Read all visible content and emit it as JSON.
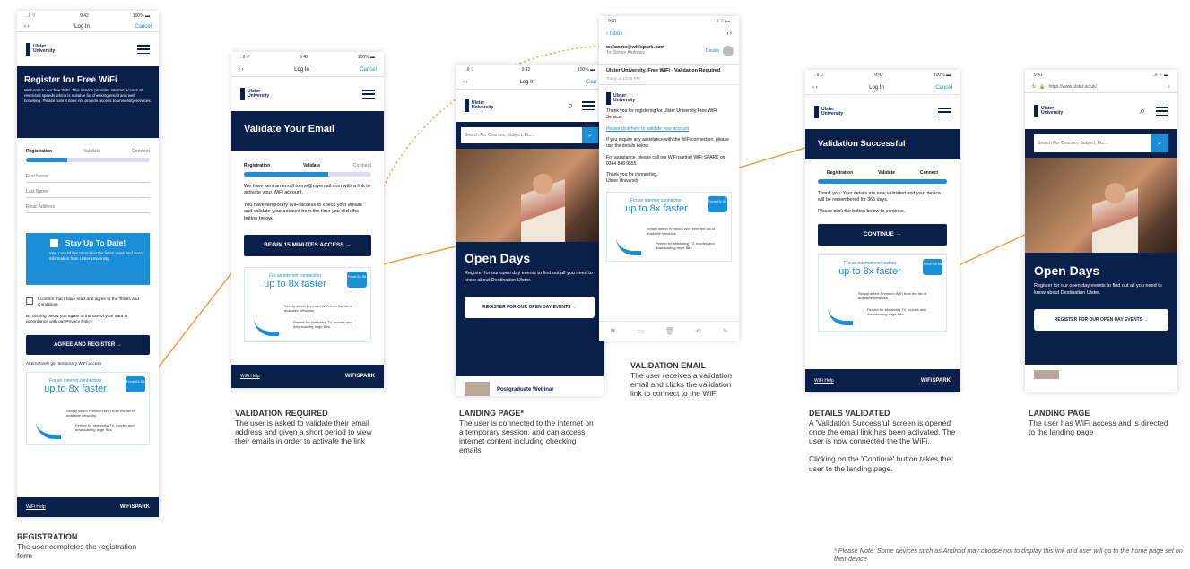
{
  "phones": {
    "registration": {
      "status": {
        "carrier": "..ll ⌔",
        "time": "9:42",
        "battery": "100% ▬"
      },
      "nav": {
        "back": "‹",
        "forward": "›",
        "title": "Log In",
        "cancel": "Cancel"
      },
      "logo": "Ulster University",
      "hero_title": "Register for Free WiFi",
      "hero_body": "Welcome to our free WiFi. This service provides internet access at restricted speeds which is suitable for checking email and web browsing. Please note it does not provide access to university services.",
      "tabs": [
        "Registration",
        "Validate",
        "Connect"
      ],
      "progress": 0.33,
      "fields": [
        "First Name",
        "Last Name",
        "Email Address"
      ],
      "promo_title": "Stay Up To Date!",
      "promo_body": "Yes, I would like to receive the latest news and event information from Ulster University",
      "terms": "I confirm that I have read and agree to the Terms and Conditions",
      "privacy": "By clicking below you agree to the use of your data in accordance with our Privacy Policy",
      "button": "AGREE AND REGISTER →",
      "alt": "Alternatively get temporary WiFi access",
      "ad": {
        "line1": "For an internet connection",
        "line2": "up to 8x faster",
        "price": "From £4.95",
        "small1": "Simply select Premium WiFi from the list of available networks",
        "small2": "Perfect for streaming TV, movies and downloading large files"
      },
      "footer_left": "WiFi Help",
      "footer_right": "WiFiSPARK"
    },
    "validate": {
      "status": {
        "carrier": "..ll ⌔",
        "time": "9:42",
        "battery": "100% ▬"
      },
      "nav": {
        "back": "‹",
        "forward": "›",
        "title": "Log In",
        "cancel": "Cancel"
      },
      "logo": "Ulster University",
      "hero_title": "Validate Your Email",
      "tabs": [
        "Registration",
        "Validate",
        "Connect"
      ],
      "progress": 0.66,
      "p1": "We have sent an email to me@myemail.com with a link to activate your WiFi account.",
      "p2": "You have temporary WiFi access to check your emails and validate your account from the time you click the button below.",
      "button": "BEGIN 15 MINUTES ACCESS →",
      "ad": {
        "line1": "For an internet connection",
        "line2": "up to 8x faster",
        "price": "From £4.95",
        "small1": "Simply select Premium WiFi from the list of available networks",
        "small2": "Perfect for streaming TV, movies and downloading large files"
      },
      "footer_left": "WiFi Help",
      "footer_right": "WiFiSPARK"
    },
    "landing1": {
      "status": {
        "carrier": "..ll ⌔",
        "time": "9:42",
        "battery": "100% ▬"
      },
      "nav": {
        "back": "‹",
        "forward": "›",
        "title": "Log In",
        "cancel": "Can"
      },
      "logo": "Ulster University",
      "search_placeholder": "Search For Courses, Subject, Etc...",
      "hero_title": "Open Days",
      "hero_body": "Register for our open day events to find out all you need to know about Destination Ulster.",
      "button": "REGISTER FOR OUR OPEN DAY EVENTS →",
      "card": "Postgraduate Webinar"
    },
    "email": {
      "status": {
        "time": "9:41",
        "battery": "..ll ⌔ ▬"
      },
      "nav": {
        "back": "‹ Inbox",
        "arrows": "‹  ›"
      },
      "from": "welcome@wifispark.com",
      "to": "To: Simon Andrews",
      "details": "Details",
      "subject": "Ulster University. Free WiFi - Validation Required",
      "date": "Today at 12:05 PM",
      "logo": "Ulster University",
      "p1": "Thank you for registering for Ulster University Free WiFi Service.",
      "link": "Please click here to validate your account",
      "p2": "If you require any assistance with the WiFi connection, please use the details below.",
      "p3": "For assistance, please call our WiFi partner WiFi SPARK on 0344 848 9555.",
      "p4": "Thank you for connecting,",
      "p5": "Ulster University",
      "ad": {
        "line1": "For an internet connection",
        "line2": "up to 8x faster",
        "price": "From £4.95",
        "small1": "Simply select Premium WiFi from the list of available networks",
        "small2": "Perfect for streaming TV, movies and downloading large files"
      }
    },
    "success": {
      "status": {
        "carrier": "..ll ⌔",
        "time": "9:42",
        "battery": "100% ▬"
      },
      "nav": {
        "back": "‹",
        "forward": "›",
        "title": "Log In",
        "cancel": "Cancel"
      },
      "logo": "Ulster University",
      "hero_title": "Validation Successful",
      "tabs": [
        "Registration",
        "Validate",
        "Connect"
      ],
      "progress": 1.0,
      "p1": "Thank you. Your details are now validated and your device will be remembered for 365 days.",
      "p2": "Please click the button below to continue.",
      "button": "CONTINUE →",
      "ad": {
        "line1": "For an internet connection",
        "line2": "up to 8x faster",
        "price": "From £4.95",
        "small1": "Simply select Premium WiFi from the list of available networks",
        "small2": "Perfect for streaming TV, movies and downloading large files"
      },
      "footer_left": "WiFi Help",
      "footer_right": "WiFiSPARK"
    },
    "landing2": {
      "status": {
        "time": "9:41",
        "battery": "..ll ⌔ ▬"
      },
      "url": "https://www.ulster.ac.uk/",
      "logo": "Ulster University",
      "search_placeholder": "Search For Courses, Subject, Etc...",
      "hero_title": "Open Days",
      "hero_body": "Register for our open day events to find out all you need to know about Destination Ulster.",
      "button": "REGISTER FOR OUR OPEN DAY EVENTS →"
    }
  },
  "captions": {
    "registration": {
      "head": "REGISTRATION",
      "body": "The user completes the registration form"
    },
    "validation_required": {
      "head": "VALIDATION REQUIRED",
      "body": "The user is asked to validate their email address and given a short period to view their emails in order to activate the link"
    },
    "landing_page_temp": {
      "head": "LANDING PAGE*",
      "body": "The user is connected to the internet on a temporary session, and can access internet content including checking emails"
    },
    "validation_email": {
      "head": "VALIDATION EMAIL",
      "body": "The user receives a validation email and clicks the validation link to connect to the WiFi"
    },
    "details_validated": {
      "head": "DETAILS VALIDATED",
      "body": "A 'Validation Successful' screen is opened once the email link has been activated.  The user is now connected the the WiFi.",
      "body2": "Clicking on the 'Continue' button takes the user to the landing page."
    },
    "landing_page_final": {
      "head": "LANDING PAGE",
      "body": "The user has WiFi access and is directed to the landing page"
    },
    "note": "* Please Note: Some devices such as Android may choose not to display this link and user will go to the home page set on their device"
  },
  "colors": {
    "navy": "#0a1f4a",
    "blue": "#1a8fd8",
    "connector": "#f0a040"
  }
}
